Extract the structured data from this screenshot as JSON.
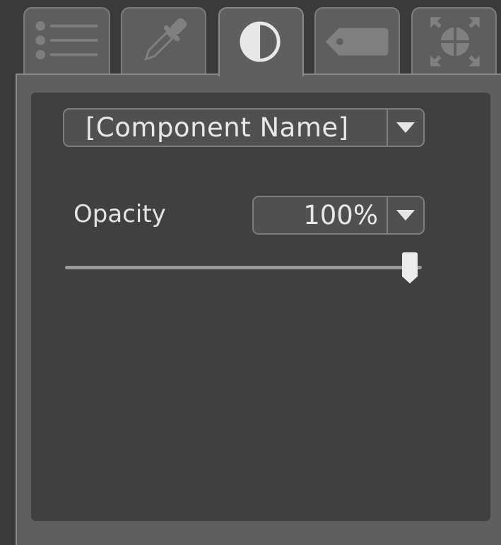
{
  "tabs": [
    {
      "id": "list",
      "icon": "list-icon",
      "active": false
    },
    {
      "id": "eyedropper",
      "icon": "eyedropper-icon",
      "active": false
    },
    {
      "id": "opacity",
      "icon": "contrast-half-circle-icon",
      "active": true
    },
    {
      "id": "tag",
      "icon": "tag-icon",
      "active": false
    },
    {
      "id": "transform",
      "icon": "expand-arrows-target-icon",
      "active": false
    }
  ],
  "component_select": {
    "value": "[Component Name]"
  },
  "opacity": {
    "label": "Opacity",
    "value_text": "100%",
    "value": 1.0
  },
  "colors": {
    "background": "#3a3a3a",
    "panel": "#5f5f5f",
    "panel_inner": "#404040",
    "control": "#505050",
    "border": "#7e7e7e",
    "text": "#e8e8e8"
  }
}
